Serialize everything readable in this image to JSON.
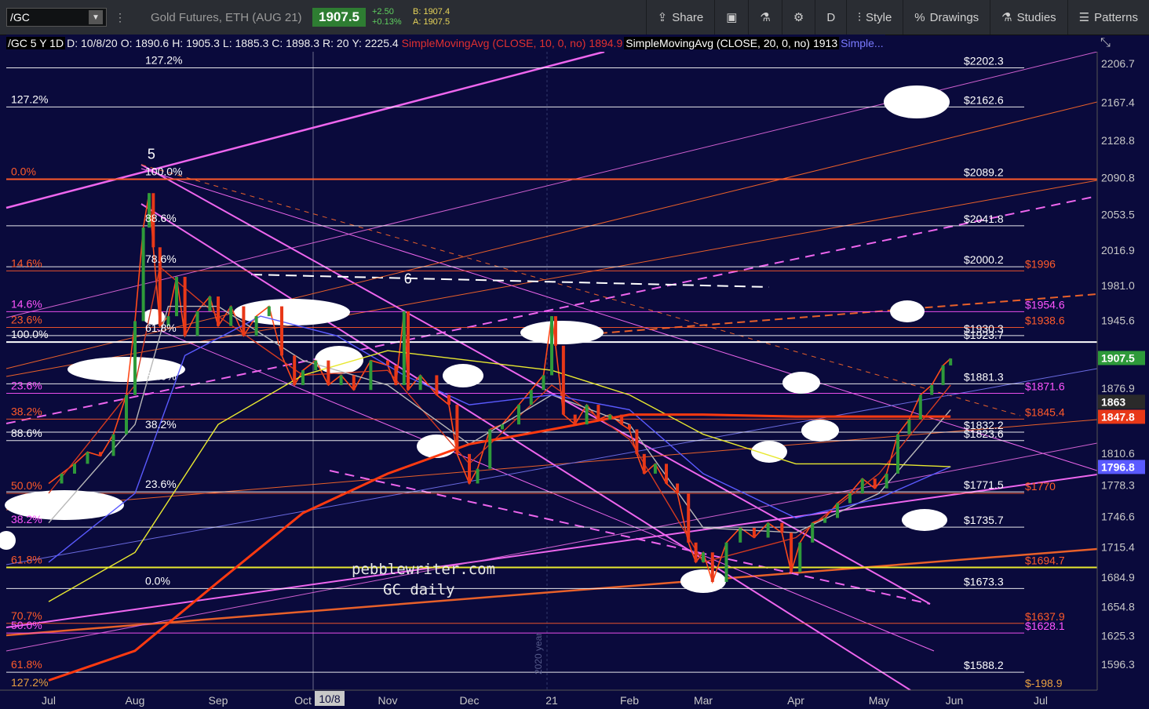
{
  "toolbar": {
    "symbol": "/GC",
    "name": "Gold Futures, ETH (AUG 21)",
    "price": "1907.5",
    "change": "+2.50",
    "change_pct": "+0.13%",
    "bid": "B: 1907.4",
    "ask": "A: 1907.5",
    "share": "Share",
    "timeframe": "D",
    "style": "Style",
    "drawings": "Drawings",
    "studies": "Studies",
    "patterns": "Patterns"
  },
  "legend": {
    "sym": "/GC 5 Y 1D",
    "date": "D: 10/8/20",
    "open": "O: 1890.6",
    "high": "H: 1905.3",
    "low": "L: 1885.3",
    "close": "C: 1898.3",
    "range": "R: 20",
    "y": "Y: 2225.4",
    "sma10": "SimpleMovingAvg (CLOSE, 10, 0, no)",
    "sma10_val": "1894.9",
    "sma20": "SimpleMovingAvg (CLOSE, 20, 0, no)",
    "sma20_val": "1913",
    "more": "Simple..."
  },
  "watermark": {
    "line1": "pebblewriter.com",
    "line2": "GC daily"
  },
  "cursor_date": "10/8",
  "year_marker": "2020 year",
  "chart_data": {
    "type": "candlestick",
    "ylim": [
      1575,
      2225
    ],
    "y_ticks": [
      2206.7,
      2167.4,
      2128.8,
      2090.8,
      2053.5,
      2016.9,
      1981,
      1945.6,
      1876.9,
      1810.6,
      1778.3,
      1746.6,
      1715.4,
      1684.9,
      1654.8,
      1625.3,
      1596.3
    ],
    "x_labels": [
      "Jul",
      "Aug",
      "Sep",
      "Oct",
      "Nov",
      "Dec",
      "21",
      "Feb",
      "Mar",
      "Apr",
      "May",
      "Jun",
      "Jul"
    ],
    "price_badges": [
      {
        "label": "1907.5",
        "value": 1907.5,
        "color": "#2e9a3a"
      },
      {
        "label": "1863",
        "value": 1863,
        "color": "#2a2a2a"
      },
      {
        "label": "1847.8",
        "value": 1847.8,
        "color": "#e83818"
      },
      {
        "label": "1796.8",
        "value": 1796.8,
        "color": "#5a5aff"
      }
    ],
    "levels": [
      {
        "value": 2202.3,
        "label": "$2202.3",
        "color": "#ffffff"
      },
      {
        "value": 2162.6,
        "label": "$2162.6",
        "color": "#ffffff"
      },
      {
        "value": 2089.2,
        "label": "$2089.2",
        "color": "#ffffff"
      },
      {
        "value": 2041.8,
        "label": "$2041.8",
        "color": "#ffffff"
      },
      {
        "value": 2000.2,
        "label": "$2000.2",
        "color": "#ffffff"
      },
      {
        "value": 1996,
        "label": "$1996",
        "color": "#ff5a2a"
      },
      {
        "value": 1954.6,
        "label": "$1954.6",
        "color": "#ff55ff"
      },
      {
        "value": 1938.6,
        "label": "$1938.6",
        "color": "#ff5a2a"
      },
      {
        "value": 1930.3,
        "label": "$1930.3",
        "color": "#ffffff"
      },
      {
        "value": 1923.7,
        "label": "$1923.7",
        "color": "#ffffff"
      },
      {
        "value": 1881.3,
        "label": "$1881.3",
        "color": "#ffffff"
      },
      {
        "value": 1871.6,
        "label": "$1871.6",
        "color": "#ff55ff"
      },
      {
        "value": 1845.4,
        "label": "$1845.4",
        "color": "#ff5a2a"
      },
      {
        "value": 1832.2,
        "label": "$1832.2",
        "color": "#ffffff"
      },
      {
        "value": 1823.6,
        "label": "$1823.6",
        "color": "#ffffff"
      },
      {
        "value": 1771.5,
        "label": "$1771.5",
        "color": "#ffffff"
      },
      {
        "value": 1770,
        "label": "$1770",
        "color": "#ff5a2a"
      },
      {
        "value": 1735.7,
        "label": "$1735.7",
        "color": "#ffffff"
      },
      {
        "value": 1694.7,
        "label": "$1694.7",
        "color": "#ff5a2a"
      },
      {
        "value": 1673.3,
        "label": "$1673.3",
        "color": "#ffffff"
      },
      {
        "value": 1637.9,
        "label": "$1637.9",
        "color": "#ff5a2a"
      },
      {
        "value": 1628.1,
        "label": "$1628.1",
        "color": "#ff55ff"
      },
      {
        "value": 1588.2,
        "label": "$1588.2",
        "color": "#ffffff"
      },
      {
        "value": 1570,
        "label": "$-198.9",
        "color": "#e8a040"
      }
    ],
    "fib_labels": [
      {
        "text": "127.2%",
        "value": 2202.3,
        "color": "#ffffff",
        "group": "b"
      },
      {
        "text": "127.2%",
        "value": 2162.6,
        "color": "#ffffff",
        "group": "a"
      },
      {
        "text": "0.0%",
        "value": 2089.2,
        "color": "#ff5a2a",
        "group": "a"
      },
      {
        "text": "100.0%",
        "value": 2089.2,
        "color": "#ffffff",
        "group": "b"
      },
      {
        "text": "88.6%",
        "value": 2041.8,
        "color": "#ffffff",
        "group": "b"
      },
      {
        "text": "78.6%",
        "value": 2000.2,
        "color": "#ffffff",
        "group": "b"
      },
      {
        "text": "14.6%",
        "value": 1996,
        "color": "#ff5a2a",
        "group": "a"
      },
      {
        "text": "14.6%",
        "value": 1954.6,
        "color": "#ff55ff",
        "group": "a"
      },
      {
        "text": "23.6%",
        "value": 1938.6,
        "color": "#ff5a2a",
        "group": "a"
      },
      {
        "text": "61.8%",
        "value": 1930.3,
        "color": "#ffffff",
        "group": "b"
      },
      {
        "text": "100.0%",
        "value": 1923.7,
        "color": "#ffffff",
        "group": "a"
      },
      {
        "text": "50.0%",
        "value": 1881.3,
        "color": "#ffffff",
        "group": "b"
      },
      {
        "text": "23.6%",
        "value": 1871.6,
        "color": "#ff55ff",
        "group": "a"
      },
      {
        "text": "38.2%",
        "value": 1845.4,
        "color": "#ff5a2a",
        "group": "a"
      },
      {
        "text": "38.2%",
        "value": 1832.2,
        "color": "#ffffff",
        "group": "b"
      },
      {
        "text": "88.6%",
        "value": 1823.6,
        "color": "#ffffff",
        "group": "a"
      },
      {
        "text": "23.6%",
        "value": 1771.5,
        "color": "#ffffff",
        "group": "b"
      },
      {
        "text": "50.0%",
        "value": 1770,
        "color": "#ff5a2a",
        "group": "a"
      },
      {
        "text": "38.2%",
        "value": 1735.7,
        "color": "#ff55ff",
        "group": "a"
      },
      {
        "text": "61.8%",
        "value": 1694.7,
        "color": "#ff5a2a",
        "group": "a"
      },
      {
        "text": "0.0%",
        "value": 1673.3,
        "color": "#ffffff",
        "group": "b"
      },
      {
        "text": "70.7%",
        "value": 1637.9,
        "color": "#ff5a2a",
        "group": "a"
      },
      {
        "text": "50.0%",
        "value": 1628.1,
        "color": "#ff55ff",
        "group": "a"
      },
      {
        "text": "61.8%",
        "value": 1588.2,
        "color": "#ff5a2a",
        "group": "a"
      },
      {
        "text": "127.2%",
        "value": 1570,
        "color": "#e8a040",
        "group": "a"
      }
    ],
    "wave_labels": [
      {
        "text": "5",
        "month": 1.15,
        "value": 2110
      },
      {
        "text": "6",
        "month": 4.2,
        "value": 1983
      }
    ],
    "series": [
      {
        "name": "price",
        "color": "#ff4a1a",
        "points": [
          [
            0,
            1780
          ],
          [
            0.15,
            1790
          ],
          [
            0.3,
            1800
          ],
          [
            0.45,
            1812
          ],
          [
            0.6,
            1808
          ],
          [
            0.75,
            1830
          ],
          [
            0.9,
            1870
          ],
          [
            1.0,
            1945
          ],
          [
            1.1,
            2040
          ],
          [
            1.17,
            2075
          ],
          [
            1.22,
            2020
          ],
          [
            1.3,
            1940
          ],
          [
            1.4,
            1950
          ],
          [
            1.5,
            1990
          ],
          [
            1.6,
            1930
          ],
          [
            1.75,
            1955
          ],
          [
            1.9,
            1970
          ],
          [
            2.0,
            1940
          ],
          [
            2.15,
            1960
          ],
          [
            2.3,
            1930
          ],
          [
            2.45,
            1950
          ],
          [
            2.6,
            1960
          ],
          [
            2.75,
            1910
          ],
          [
            2.9,
            1880
          ],
          [
            3.0,
            1895
          ],
          [
            3.15,
            1905
          ],
          [
            3.3,
            1880
          ],
          [
            3.45,
            1890
          ],
          [
            3.6,
            1875
          ],
          [
            3.8,
            1905
          ],
          [
            4.0,
            1900
          ],
          [
            4.1,
            1880
          ],
          [
            4.2,
            1955
          ],
          [
            4.25,
            1875
          ],
          [
            4.4,
            1890
          ],
          [
            4.6,
            1870
          ],
          [
            4.75,
            1860
          ],
          [
            4.85,
            1810
          ],
          [
            5.0,
            1780
          ],
          [
            5.1,
            1795
          ],
          [
            5.25,
            1835
          ],
          [
            5.4,
            1840
          ],
          [
            5.6,
            1860
          ],
          [
            5.75,
            1875
          ],
          [
            5.9,
            1890
          ],
          [
            6.0,
            1950
          ],
          [
            6.05,
            1920
          ],
          [
            6.15,
            1850
          ],
          [
            6.3,
            1840
          ],
          [
            6.45,
            1860
          ],
          [
            6.6,
            1845
          ],
          [
            6.75,
            1850
          ],
          [
            6.9,
            1840
          ],
          [
            7.0,
            1835
          ],
          [
            7.1,
            1810
          ],
          [
            7.2,
            1790
          ],
          [
            7.35,
            1800
          ],
          [
            7.5,
            1780
          ],
          [
            7.65,
            1770
          ],
          [
            7.8,
            1720
          ],
          [
            7.9,
            1700
          ],
          [
            8.0,
            1710
          ],
          [
            8.1,
            1680
          ],
          [
            8.25,
            1720
          ],
          [
            8.4,
            1735
          ],
          [
            8.55,
            1725
          ],
          [
            8.7,
            1740
          ],
          [
            8.85,
            1730
          ],
          [
            8.95,
            1690
          ],
          [
            9.05,
            1720
          ],
          [
            9.2,
            1740
          ],
          [
            9.35,
            1745
          ],
          [
            9.5,
            1760
          ],
          [
            9.65,
            1770
          ],
          [
            9.8,
            1785
          ],
          [
            9.95,
            1775
          ],
          [
            10.1,
            1790
          ],
          [
            10.25,
            1830
          ],
          [
            10.4,
            1845
          ],
          [
            10.55,
            1870
          ],
          [
            10.7,
            1880
          ],
          [
            10.85,
            1900
          ],
          [
            10.95,
            1907
          ]
        ]
      },
      {
        "name": "SMA10",
        "color": "#d43a20",
        "points": [
          [
            0,
            1770
          ],
          [
            1,
            1880
          ],
          [
            1.3,
            2000
          ],
          [
            2,
            1950
          ],
          [
            3,
            1890
          ],
          [
            4,
            1895
          ],
          [
            5,
            1800
          ],
          [
            6,
            1880
          ],
          [
            7,
            1825
          ],
          [
            8,
            1700
          ],
          [
            9,
            1725
          ],
          [
            10,
            1790
          ],
          [
            10.95,
            1880
          ]
        ]
      },
      {
        "name": "SMA20",
        "color": "#b8b8b8",
        "points": [
          [
            0,
            1740
          ],
          [
            1,
            1840
          ],
          [
            1.4,
            1960
          ],
          [
            2,
            1960
          ],
          [
            3,
            1905
          ],
          [
            4,
            1880
          ],
          [
            5,
            1820
          ],
          [
            6,
            1870
          ],
          [
            7,
            1840
          ],
          [
            8,
            1735
          ],
          [
            9,
            1730
          ],
          [
            10,
            1770
          ],
          [
            10.95,
            1855
          ]
        ]
      },
      {
        "name": "SMA50",
        "color": "#5a5aff",
        "points": [
          [
            0,
            1700
          ],
          [
            1,
            1770
          ],
          [
            1.6,
            1910
          ],
          [
            2.5,
            1950
          ],
          [
            3.4,
            1930
          ],
          [
            4.2,
            1890
          ],
          [
            5,
            1860
          ],
          [
            6,
            1870
          ],
          [
            7,
            1855
          ],
          [
            8,
            1790
          ],
          [
            9,
            1745
          ],
          [
            10,
            1765
          ],
          [
            10.95,
            1797
          ]
        ]
      },
      {
        "name": "SMA100",
        "color": "#e8e830",
        "points": [
          [
            0,
            1660
          ],
          [
            1,
            1710
          ],
          [
            2,
            1840
          ],
          [
            3,
            1890
          ],
          [
            4,
            1915
          ],
          [
            5,
            1905
          ],
          [
            6,
            1895
          ],
          [
            7,
            1870
          ],
          [
            8,
            1830
          ],
          [
            9,
            1800
          ],
          [
            10,
            1800
          ],
          [
            10.95,
            1797
          ]
        ]
      },
      {
        "name": "SMA200",
        "color": "#ff3a10",
        "points": [
          [
            0,
            1580
          ],
          [
            1,
            1610
          ],
          [
            2,
            1680
          ],
          [
            3,
            1750
          ],
          [
            4,
            1790
          ],
          [
            5,
            1820
          ],
          [
            6,
            1835
          ],
          [
            7,
            1850
          ],
          [
            8,
            1850
          ],
          [
            9,
            1848
          ],
          [
            10,
            1848
          ],
          [
            10.95,
            1848
          ]
        ]
      }
    ]
  }
}
